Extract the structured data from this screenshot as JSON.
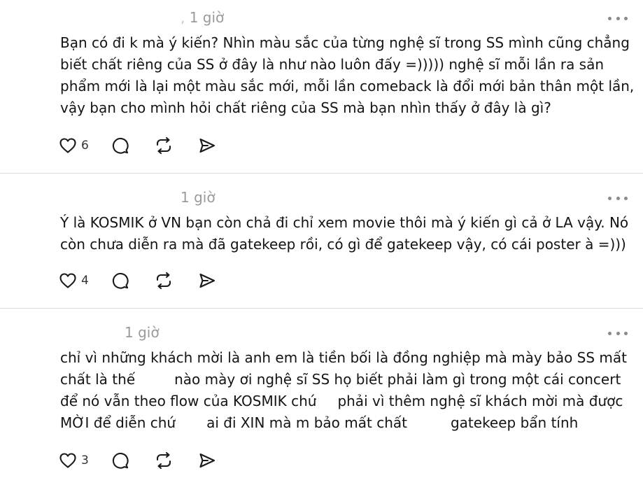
{
  "posts": [
    {
      "time": "1 giờ",
      "lines": [
        "Bạn có đi k mà ý kiến? Nhìn màu sắc của từng nghệ sĩ trong SS mình cũng chẳng",
        "biết chất riêng của SS ở đây là như nào luôn đấy =))))) nghệ sĩ mỗi lần ra sản",
        "phẩm mới là lại một màu sắc mới, mỗi lần comeback là đổi mới bản thân một lần,",
        "vậy bạn cho mình hỏi chất riêng của SS mà bạn nhìn thấy ở đây là gì?"
      ],
      "likes": "6"
    },
    {
      "time": "1 giờ",
      "lines": [
        "Ý là KOSMIK ở VN bạn còn chả đi chỉ xem movie thôi mà ý kiến gì cả ở LA vậy. Nó",
        "còn chưa diễn ra mà đã gatekeep rồi, có gì để gatekeep vậy, có cái poster à =)))"
      ],
      "likes": "4"
    },
    {
      "time": "1 giờ",
      "lines": [
        "chỉ vì những khách mời là anh em là tiền bối là đồng nghiệp mà mày bảo SS mất",
        "chất là thế",
        "nào mày ơi nghệ sĩ SS họ biết phải làm gì trong một cái concert",
        "để nó vẫn theo flow của KOSMIK chứ",
        "phải vì thêm nghệ sĩ khách mời mà được",
        "MỜI để diễn chứ",
        "ai đi XIN mà m bảo mất chất",
        "gatekeep bẩn tính"
      ],
      "likes": "3"
    }
  ],
  "icons": [
    "heart-icon",
    "comment-icon",
    "repost-icon",
    "share-icon",
    "more-icon"
  ]
}
